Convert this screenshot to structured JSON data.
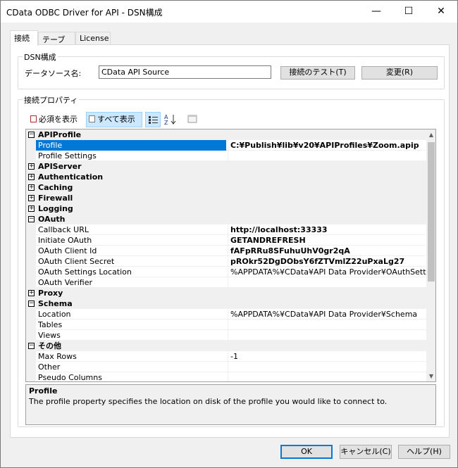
{
  "window": {
    "title": "CData ODBC Driver for API - DSN構成",
    "minimize": "—",
    "maximize": "☐",
    "close": "✕"
  },
  "tabs": [
    {
      "label": "接続",
      "active": true
    },
    {
      "label": "テーブル",
      "active": false
    },
    {
      "label": "License",
      "active": false
    }
  ],
  "dsn_group": {
    "label": "DSN構成",
    "datasource_label": "データソース名:",
    "datasource_value": "CData API Source",
    "test_button": "接続のテスト(T)",
    "change_button": "変更(R)"
  },
  "props_group": {
    "label": "接続プロパティ",
    "show_required": "必須を表示",
    "show_all": "すべて表示"
  },
  "grid": {
    "rows": [
      {
        "type": "cat",
        "name": "APIProfile",
        "expanded": true
      },
      {
        "type": "prop",
        "name": "Profile",
        "value": "C:¥Publish¥lib¥v20¥APIProfiles¥Zoom.apip",
        "selected": true,
        "bold": true
      },
      {
        "type": "prop",
        "name": "Profile Settings",
        "value": ""
      },
      {
        "type": "cat",
        "name": "APIServer",
        "expanded": false
      },
      {
        "type": "cat",
        "name": "Authentication",
        "expanded": false
      },
      {
        "type": "cat",
        "name": "Caching",
        "expanded": false
      },
      {
        "type": "cat",
        "name": "Firewall",
        "expanded": false
      },
      {
        "type": "cat",
        "name": "Logging",
        "expanded": false
      },
      {
        "type": "cat",
        "name": "OAuth",
        "expanded": true
      },
      {
        "type": "prop",
        "name": "Callback URL",
        "value": "http://localhost:33333",
        "bold": true
      },
      {
        "type": "prop",
        "name": "Initiate OAuth",
        "value": "GETANDREFRESH",
        "bold": true
      },
      {
        "type": "prop",
        "name": "OAuth Client Id",
        "value": "fAFpRRu8SFuhuUhV0gr2qA",
        "bold": true
      },
      {
        "type": "prop",
        "name": "OAuth Client Secret",
        "value": "pROkr52DgDObsY6fZTVmlZ22uPxaLg27",
        "bold": true
      },
      {
        "type": "prop",
        "name": "OAuth Settings Location",
        "value": "%APPDATA%¥CData¥API Data Provider¥OAuthSettings.txt"
      },
      {
        "type": "prop",
        "name": "OAuth Verifier",
        "value": ""
      },
      {
        "type": "cat",
        "name": "Proxy",
        "expanded": false
      },
      {
        "type": "cat",
        "name": "Schema",
        "expanded": true
      },
      {
        "type": "prop",
        "name": "Location",
        "value": "%APPDATA%¥CData¥API Data Provider¥Schema"
      },
      {
        "type": "prop",
        "name": "Tables",
        "value": ""
      },
      {
        "type": "prop",
        "name": "Views",
        "value": ""
      },
      {
        "type": "cat",
        "name": "その他",
        "expanded": true
      },
      {
        "type": "prop",
        "name": "Max Rows",
        "value": "-1"
      },
      {
        "type": "prop",
        "name": "Other",
        "value": ""
      },
      {
        "type": "prop",
        "name": "Pseudo Columns",
        "value": ""
      }
    ]
  },
  "help": {
    "title": "Profile",
    "description": "The profile property specifies the location on disk of the profile you would like to connect to."
  },
  "buttons": {
    "ok": "OK",
    "cancel": "キャンセル(C)",
    "help": "ヘルプ(H)"
  }
}
